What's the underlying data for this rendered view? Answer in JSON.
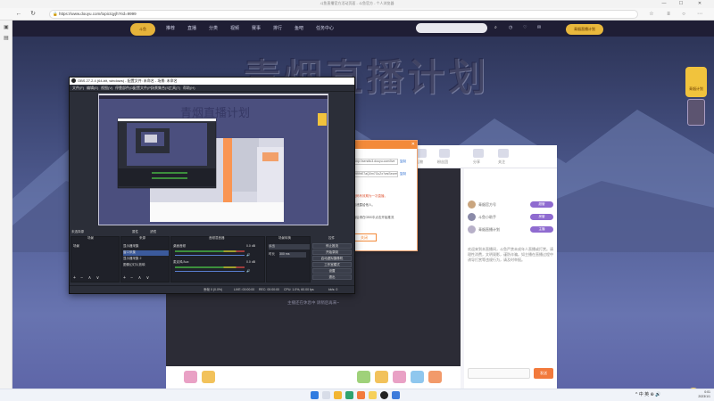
{
  "browser": {
    "window_title": "斗鱼直播官方活动页面 - 斗鱼官方 - 个人浏览器",
    "url": "https://www.douyu.com/topic/qyjh?rid=9999",
    "win_min": "—",
    "win_max": "☐",
    "win_close": "✕",
    "back": "←",
    "refresh": "↻",
    "lock": "🔒"
  },
  "site": {
    "logo": "斗鱼",
    "nav": [
      "推荐",
      "直播",
      "分类",
      "视频",
      "赛事",
      "排行",
      "鱼吧",
      "任务中心"
    ],
    "banner_title": "青烟直播计划",
    "right_badge": "青烟直播计划",
    "float_badge": "青烟计划"
  },
  "live_room": {
    "top_icons": [
      "任务",
      "签到",
      "礼物",
      "粉丝团",
      "分享",
      "关注"
    ],
    "offline_message": "主播还在休息中 请稍后再来~",
    "chat_rows": [
      {
        "name": "青烟官方号",
        "pill": "超管"
      },
      {
        "name": "斗鱼小助手",
        "pill": "房管"
      },
      {
        "name": "青烟直播计划",
        "pill": "主播"
      }
    ],
    "chat_text": "欢迎来到本直播间，斗鱼严禁未成年人直播或打赏。请理性消费，文明观影，谨防诈骗。如主播在直播过程中诱导打赏等违规行为，请及时举报。",
    "send": "发送"
  },
  "popup": {
    "field1": "rtmp://sendtc3.douyu.com/live",
    "field2": "9999rE7aQ0m7GcZx?wsSecret",
    "link1": "复制",
    "link2": "复制",
    "text1": "推流码有效期为一次直播，",
    "text2": "请勿泄露给他人。",
    "text3": "开播后请在OBS中点击开始推流",
    "button": "关闭"
  },
  "obs": {
    "title": "OBS 27.2.4 (64-bit, windows) - 配置文件: 未命名 - 场景: 未命名",
    "menu": [
      "文件(F)",
      "编辑(E)",
      "视图(V)",
      "停靠部件(D)",
      "配置文件(P)",
      "场景集合(S)",
      "工具(T)",
      "帮助(H)"
    ],
    "dock_headers": [
      "未选择源",
      "属性",
      "滤镜",
      "场景",
      "来源",
      "音频混音器",
      "场景转换",
      "控件"
    ],
    "scenes": [
      "场景"
    ],
    "sources": [
      "显示器采集",
      "窗口采集",
      "显示器采集 2",
      "图像幻灯片放映"
    ],
    "mixer": [
      {
        "name": "桌面音频",
        "db": "0.0 dB"
      },
      {
        "name": "麦克风/Aux",
        "db": "0.0 dB"
      }
    ],
    "transition": "淡出",
    "duration_label": "时长",
    "duration": "300 ms",
    "controls": [
      "停止推流",
      "开始录制",
      "启动虚拟摄像机",
      "工作室模式",
      "设置",
      "退出"
    ],
    "status": {
      "dropped": "丢帧 0 (0.0%)",
      "live": "LIVE: 00:00:00",
      "rec": "REC: 00:00:00",
      "cpu": "CPU: 1.0%, 60.00 fps",
      "kbps": "kb/s: 0"
    },
    "tools": "+ − ∧ ∨"
  },
  "taskbar": {
    "tray": "^ 中 英 ⊕ 🔊",
    "time": "0:01",
    "date": "2023/1/1"
  },
  "colors": {
    "accent_orange": "#f38a3a",
    "obs_bg": "#2b2e38",
    "page_purple": "#55629a"
  }
}
